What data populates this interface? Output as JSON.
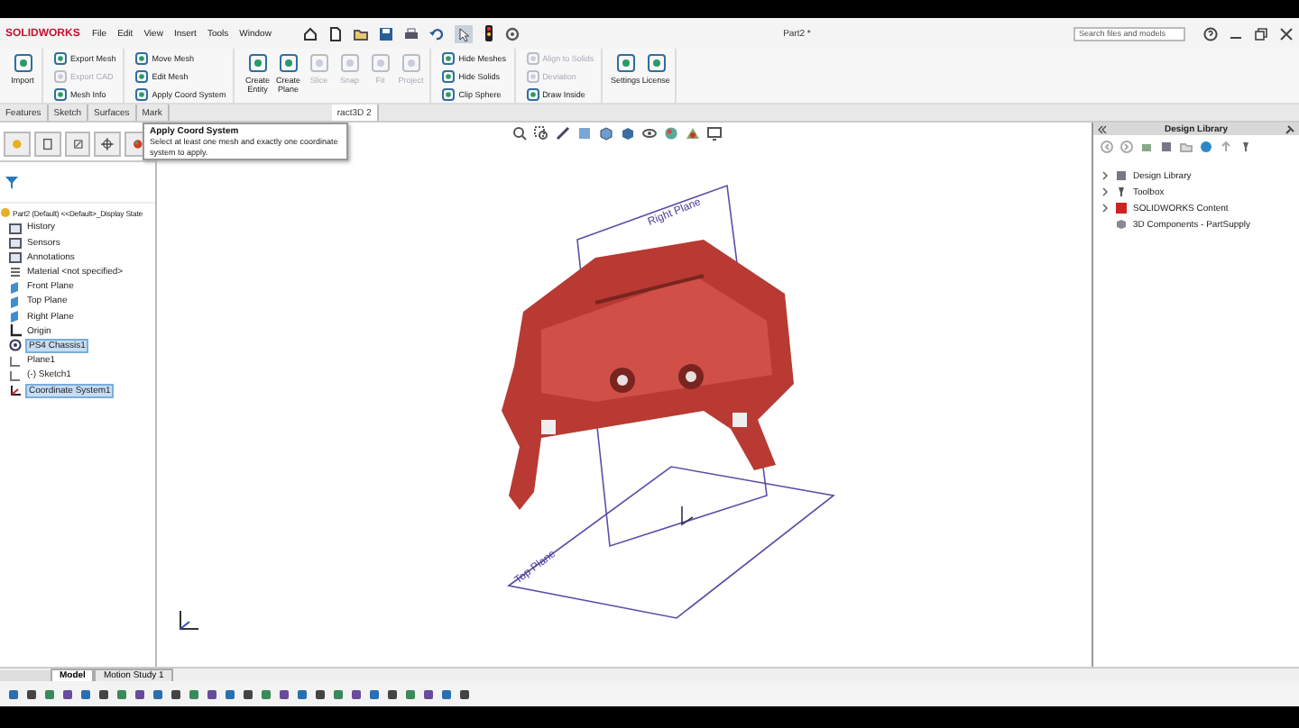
{
  "app": {
    "logo": "SOLIDWORKS",
    "menu": [
      "File",
      "Edit",
      "View",
      "Insert",
      "Tools",
      "Window"
    ],
    "title": "Part2 *",
    "search": {
      "placeholder": "Search files and models"
    }
  },
  "ribbon": {
    "groups": [
      {
        "kind": "large",
        "items": [
          {
            "label": "Import",
            "disabled": false
          }
        ]
      },
      {
        "kind": "small",
        "items": [
          {
            "label": "Export Mesh",
            "disabled": false
          },
          {
            "label": "Export CAD",
            "disabled": true
          },
          {
            "label": "Mesh Info",
            "disabled": false
          }
        ]
      },
      {
        "kind": "small",
        "items": [
          {
            "label": "Move Mesh",
            "disabled": false
          },
          {
            "label": "Edit Mesh",
            "disabled": false
          },
          {
            "label": "Apply Coord System",
            "disabled": false
          }
        ]
      },
      {
        "kind": "large",
        "items": [
          {
            "label": "Create Entity",
            "disabled": false
          },
          {
            "label": "Create Plane",
            "disabled": false
          },
          {
            "label": "Slice",
            "disabled": true
          },
          {
            "label": "Snap",
            "disabled": true
          },
          {
            "label": "Fit",
            "disabled": true
          },
          {
            "label": "Project",
            "disabled": true
          }
        ]
      },
      {
        "kind": "small",
        "items": [
          {
            "label": "Hide Meshes",
            "disabled": false
          },
          {
            "label": "Hide Solids",
            "disabled": false
          },
          {
            "label": "Clip Sphere",
            "disabled": false
          }
        ]
      },
      {
        "kind": "small",
        "items": [
          {
            "label": "Align to Solids",
            "disabled": true
          },
          {
            "label": "Deviation",
            "disabled": true
          },
          {
            "label": "Draw Inside",
            "disabled": false
          }
        ]
      },
      {
        "kind": "large",
        "items": [
          {
            "label": "Settings",
            "disabled": false
          },
          {
            "label": "License",
            "disabled": false
          }
        ]
      }
    ]
  },
  "command_tabs": [
    {
      "label": "Features",
      "selected": false
    },
    {
      "label": "Sketch",
      "selected": false
    },
    {
      "label": "Surfaces",
      "selected": false
    },
    {
      "label": "Mark",
      "selected": false
    },
    {
      "label": "ract3D 2",
      "selected": true
    }
  ],
  "tooltip": {
    "title": "Apply Coord System",
    "text": "Select at least one mesh and exactly one coordinate system to apply."
  },
  "feature_tree": {
    "root": "Part2 (Default) <<Default>_Display State",
    "items": [
      {
        "label": "History",
        "kind": "folder",
        "selected": false
      },
      {
        "label": "Sensors",
        "kind": "folder",
        "selected": false
      },
      {
        "label": "Annotations",
        "kind": "folder",
        "selected": false
      },
      {
        "label": "Material <not specified>",
        "kind": "material",
        "selected": false
      },
      {
        "label": "Front Plane",
        "kind": "plane",
        "selected": false
      },
      {
        "label": "Top Plane",
        "kind": "plane",
        "selected": false
      },
      {
        "label": "Right Plane",
        "kind": "plane",
        "selected": false
      },
      {
        "label": "Origin",
        "kind": "origin",
        "selected": false
      },
      {
        "label": "PS4 Chassis1",
        "kind": "mesh",
        "selected": true
      },
      {
        "label": "Plane1",
        "kind": "sketch",
        "selected": false
      },
      {
        "label": "(-) Sketch1",
        "kind": "sketch",
        "selected": false
      },
      {
        "label": "Coordinate System1",
        "kind": "coord",
        "selected": true
      }
    ]
  },
  "viewport": {
    "plane_labels": [
      "Right Plane",
      "Top Plane"
    ]
  },
  "design_library": {
    "title": "Design Library",
    "items": [
      {
        "label": "Design Library",
        "expandable": true
      },
      {
        "label": "Toolbox",
        "expandable": true
      },
      {
        "label": "SOLIDWORKS Content",
        "expandable": true
      },
      {
        "label": "3D Components - PartSupply",
        "expandable": false
      }
    ]
  },
  "bottom_tabs": [
    {
      "label": "Model",
      "selected": true
    },
    {
      "label": "Motion Study 1",
      "selected": false
    }
  ]
}
